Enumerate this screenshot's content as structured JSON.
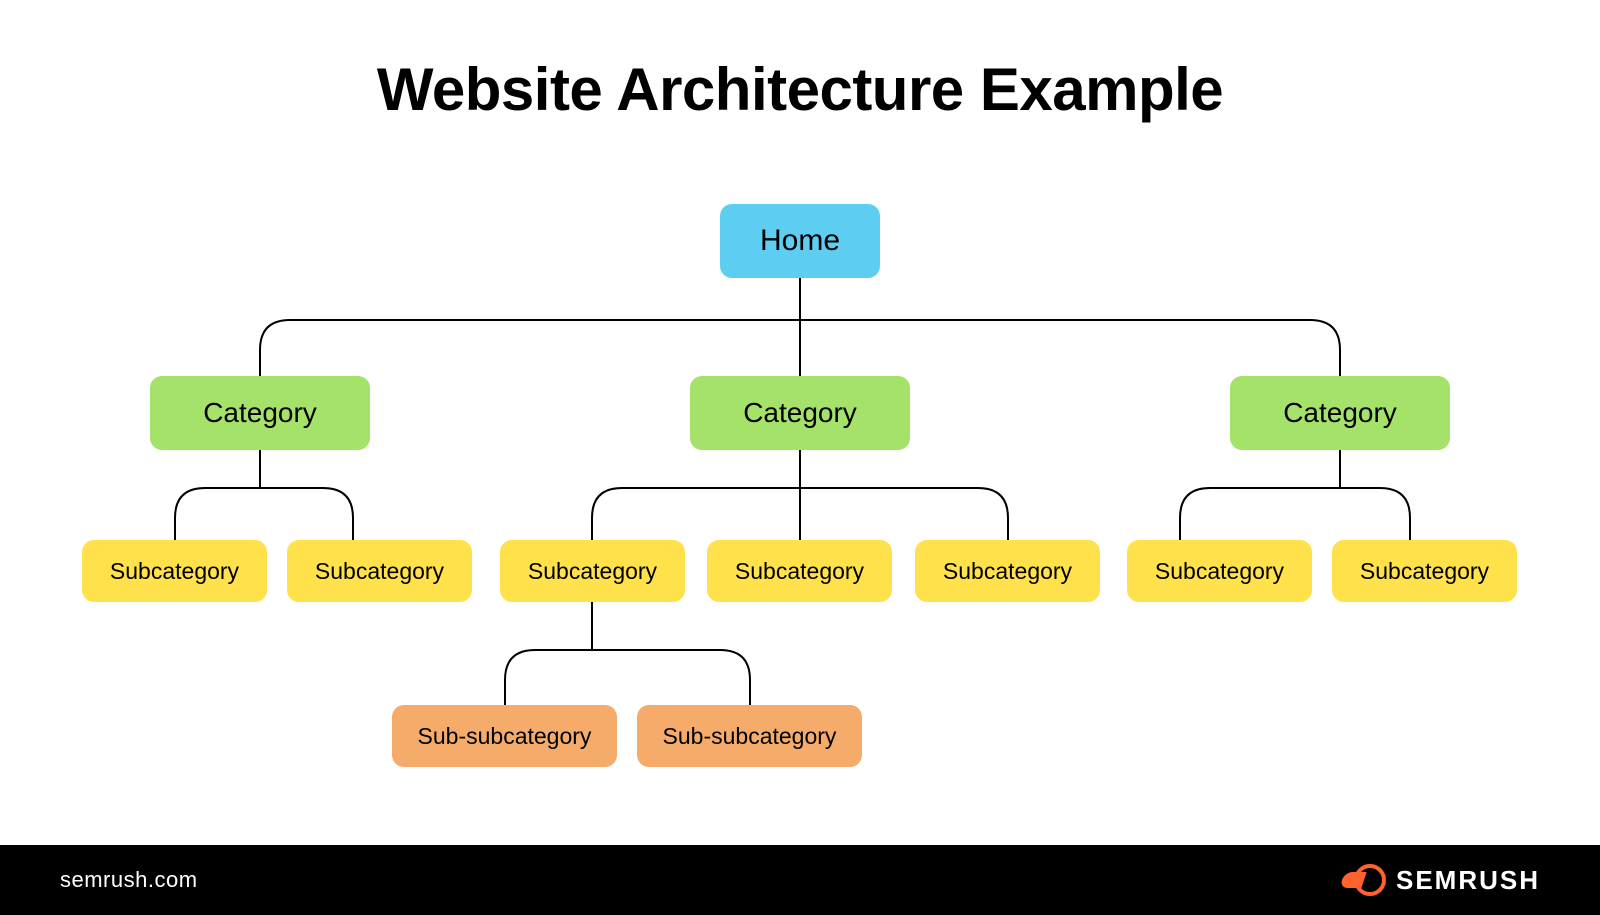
{
  "title": "Website Architecture Example",
  "colors": {
    "home": "#5ecdf2",
    "category": "#a4e26a",
    "subcategory": "#ffe24b",
    "subsubcategory": "#f5ab6a"
  },
  "nodes": {
    "home": "Home",
    "cat1": "Category",
    "cat2": "Category",
    "cat3": "Category",
    "sub1a": "Subcategory",
    "sub1b": "Subcategory",
    "sub2a": "Subcategory",
    "sub2b": "Subcategory",
    "sub2c": "Subcategory",
    "sub3a": "Subcategory",
    "sub3b": "Subcategory",
    "subsub1": "Sub-subcategory",
    "subsub2": "Sub-subcategory"
  },
  "footer": {
    "site": "semrush.com",
    "brand": "SEMRUSH"
  }
}
